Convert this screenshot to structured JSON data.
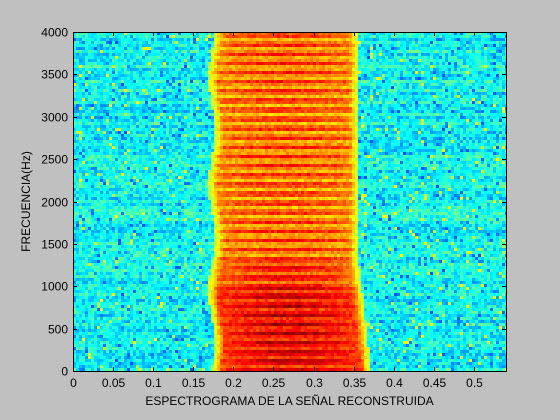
{
  "colors": {
    "figure_background": "#c0c0c0",
    "axes_frame": "#000000",
    "colormap": "jet"
  },
  "chart_data": {
    "type": "heatmap",
    "title": "",
    "xlabel": "ESPECTROGRAMA DE LA SEÑAL RECONSTRUIDA",
    "ylabel": "FRECUENCIA(Hz)",
    "xlim": [
      0,
      0.54
    ],
    "ylim": [
      0,
      4000
    ],
    "x_ticks": [
      0,
      0.05,
      0.1,
      0.15,
      0.2,
      0.25,
      0.3,
      0.35,
      0.4,
      0.45,
      0.5
    ],
    "x_tick_labels": [
      "0",
      "0.05",
      "0.1",
      "0.15",
      "0.2",
      "0.25",
      "0.3",
      "0.35",
      "0.4",
      "0.45",
      "0.5"
    ],
    "y_ticks": [
      0,
      500,
      1000,
      1500,
      2000,
      2500,
      3000,
      3500,
      4000
    ],
    "y_tick_labels": [
      "0",
      "500",
      "1000",
      "1500",
      "2000",
      "2500",
      "3000",
      "3500",
      "4000"
    ],
    "grid": false,
    "colormap": "jet",
    "regions": [
      {
        "x_range": [
          0,
          0.17
        ],
        "y_range": [
          0,
          4000
        ],
        "level": "low (cyan/green noise)"
      },
      {
        "x_range": [
          0.17,
          0.37
        ],
        "y_range": [
          0,
          1300
        ],
        "level": "high (red/dark red)"
      },
      {
        "x_range": [
          0.17,
          0.36
        ],
        "y_range": [
          1300,
          4000
        ],
        "level": "medium-high (orange/yellow)"
      },
      {
        "x_range": [
          0.37,
          0.54
        ],
        "y_range": [
          0,
          4000
        ],
        "level": "low (cyan/green noise)"
      }
    ],
    "harmonic_spacing_hz": 110
  }
}
